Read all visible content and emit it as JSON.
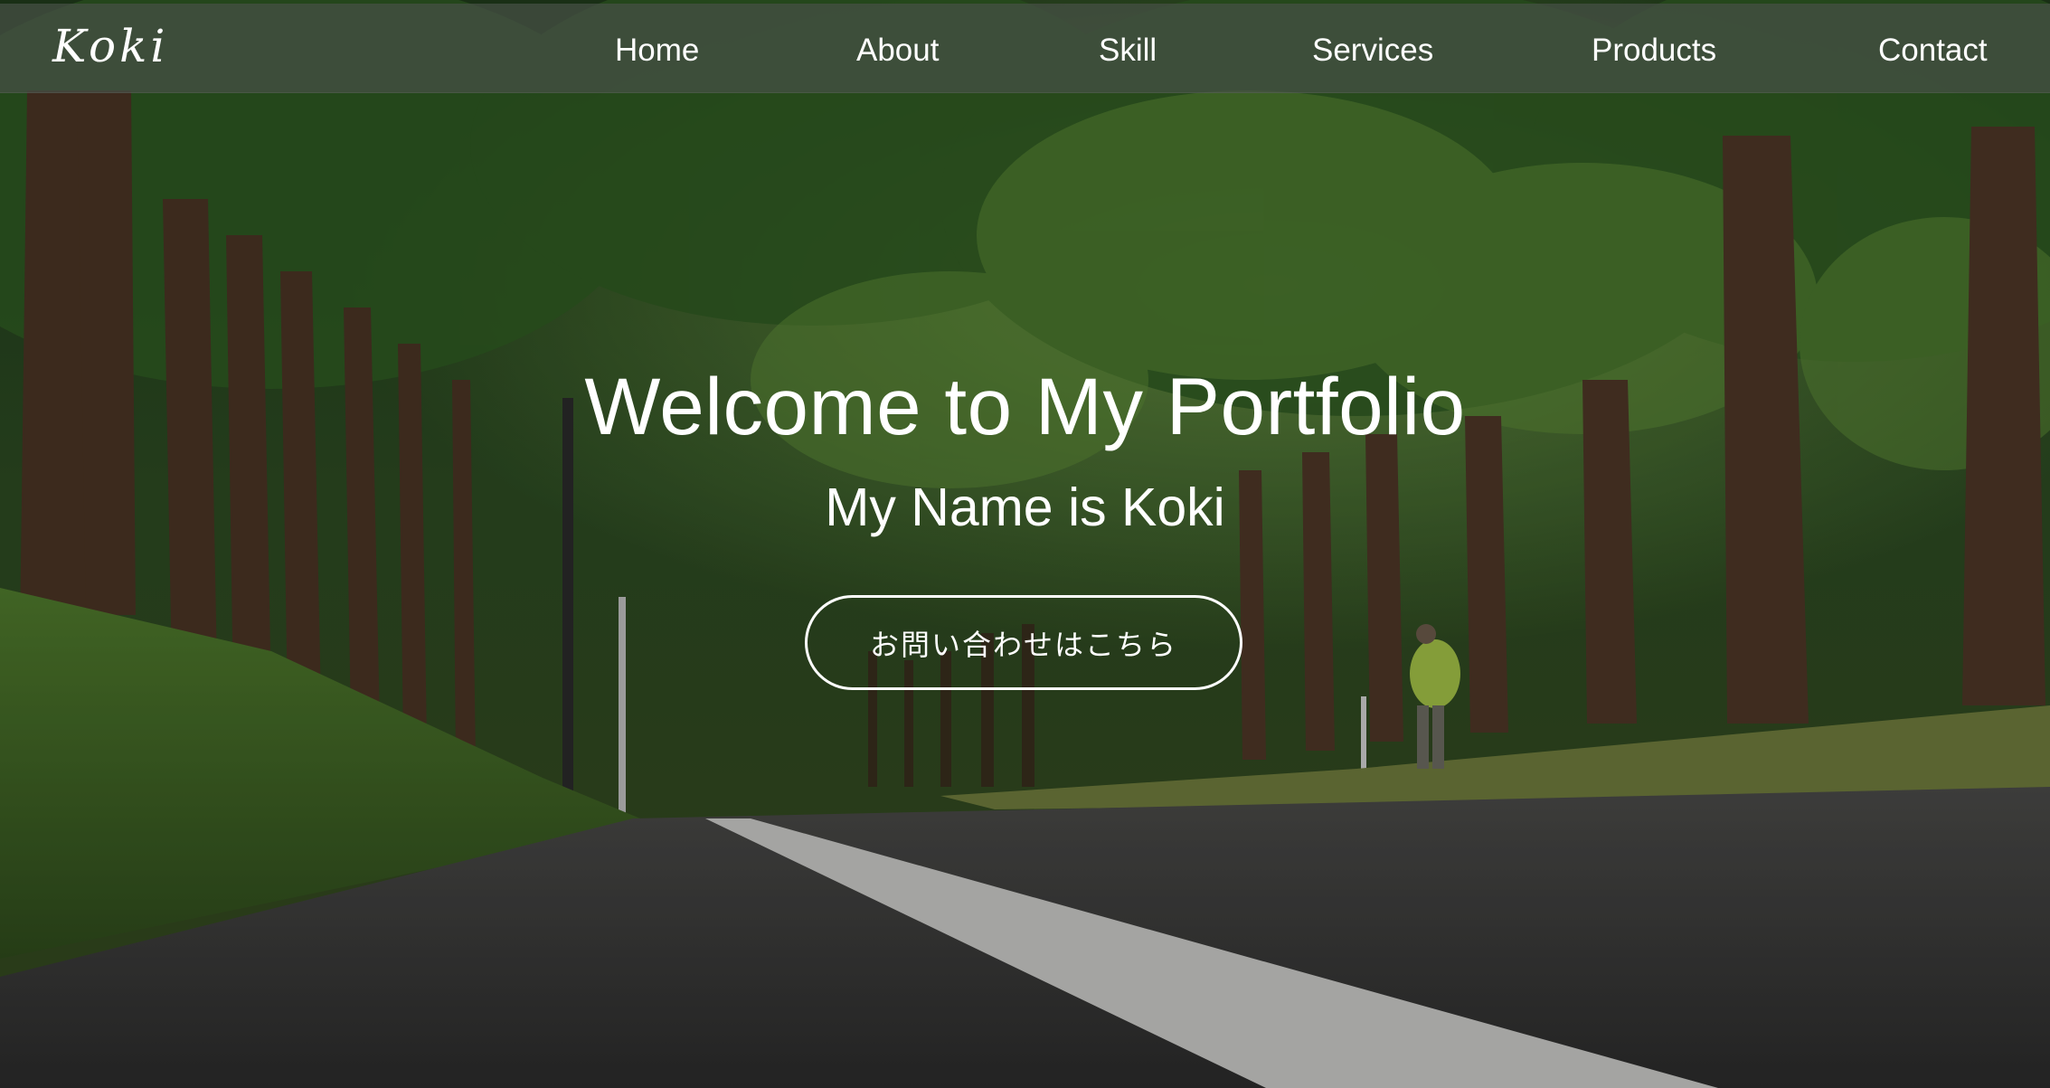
{
  "nav": {
    "logo": "Koki",
    "items": [
      {
        "label": "Home"
      },
      {
        "label": "About"
      },
      {
        "label": "Skill"
      },
      {
        "label": "Services"
      },
      {
        "label": "Products"
      },
      {
        "label": "Contact"
      }
    ]
  },
  "hero": {
    "title": "Welcome to My Portfolio",
    "subtitle": "My Name is Koki",
    "cta_label": "お問い合わせはこちら",
    "background": "photo of a tree-lined asphalt road with a white lane marking and a walking person"
  },
  "colors": {
    "text": "#ffffff",
    "nav_overlay": "#465046",
    "foliage": "#3d6a2c",
    "road": "#3a3a3a"
  }
}
